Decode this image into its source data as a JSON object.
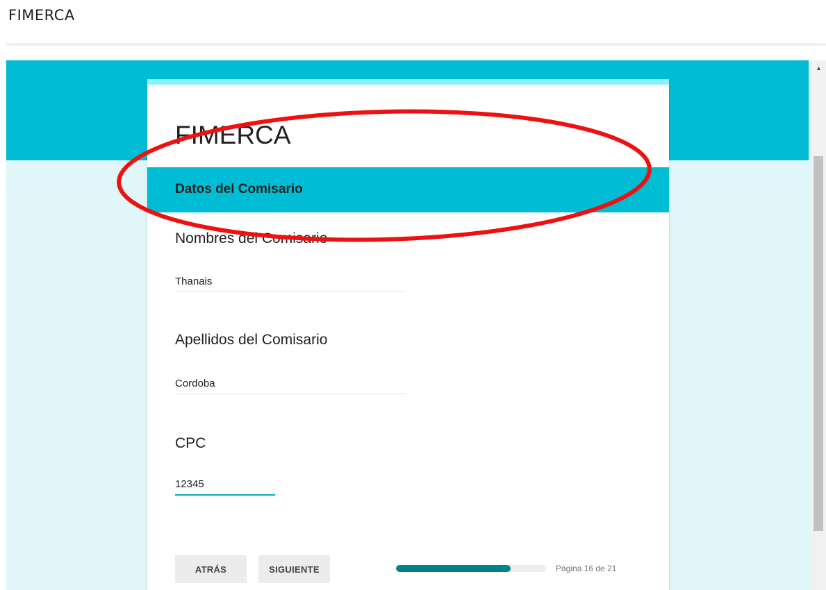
{
  "site": {
    "title": "FIMERCA"
  },
  "form": {
    "title": "FIMERCA",
    "section_title": "Datos del Comisario",
    "questions": [
      {
        "label": "Nombres del Comisario",
        "value": "Thanais"
      },
      {
        "label": "Apellidos del Comisario",
        "value": "Cordoba"
      },
      {
        "label": "CPC",
        "value": "12345"
      }
    ],
    "buttons": {
      "back": "ATRÁS",
      "next": "SIGUIENTE"
    },
    "progress": {
      "fraction": 0.762,
      "label": "Página 16 de 21"
    }
  },
  "colors": {
    "accent": "#00bcd4",
    "card_top_border": "#8ef0fa",
    "progress_fill": "#00838f",
    "annotation": "#ee1111"
  },
  "icons": {
    "scroll_up": "scroll-up-arrow-icon"
  }
}
